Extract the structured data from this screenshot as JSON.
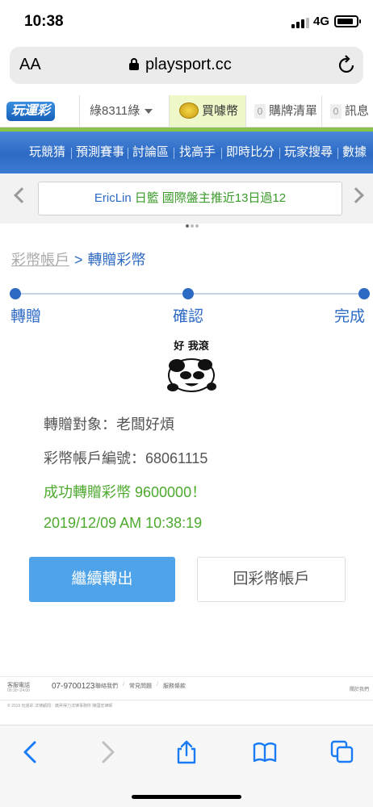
{
  "status": {
    "time": "10:38",
    "network": "4G",
    "battery_level": 0.85
  },
  "browser": {
    "aa": "AA",
    "url": "playsport.cc"
  },
  "header": {
    "logo": "玩運彩",
    "username": "綠8311綠",
    "buy_label": "買噱幣",
    "cart_count": "0",
    "cart_label": "購牌清單",
    "msg_count": "0",
    "msg_label": "訊息"
  },
  "nav": {
    "items": [
      "玩競猜",
      "預測賽事",
      "討論區",
      "找高手",
      "即時比分",
      "玩家搜尋",
      "數據"
    ]
  },
  "announcement": {
    "name": "EricLin",
    "tag": "日籃",
    "text": "國際盤主推近13日過12"
  },
  "breadcrumb": {
    "parent": "彩幣帳戶",
    "separator": ">",
    "current": "轉贈彩幣"
  },
  "steps": {
    "labels": [
      "轉贈",
      "確認",
      "完成"
    ]
  },
  "meme": {
    "caption": "好 我滾"
  },
  "result": {
    "recipient": "轉贈對象：老闆好煩",
    "account": "彩幣帳戶編號：68061115",
    "success": "成功轉贈彩幣 9600000！",
    "timestamp": "2019/12/09 AM 10:38:19"
  },
  "buttons": {
    "continue": "繼續轉出",
    "back": "回彩幣帳戶"
  },
  "footer": {
    "service_label": "客服電話",
    "service_hours": "09:30~24:00",
    "phone": "07-9700123",
    "links": [
      "聯絡我們",
      "常見問題",
      "服務條款"
    ],
    "about": "關於我們",
    "copyright": "© 2019 玩運彩 法律顧問：廣昇得力法律事務所 陳國宏律師"
  },
  "colors": {
    "brand_blue": "#2d6ac4",
    "success_green": "#4caa2e",
    "button_blue": "#4fa3e9",
    "nav_green": "#8bc34a"
  },
  "toolbar_icons": [
    "back-icon",
    "forward-icon",
    "share-icon",
    "bookmarks-icon",
    "tabs-icon"
  ]
}
